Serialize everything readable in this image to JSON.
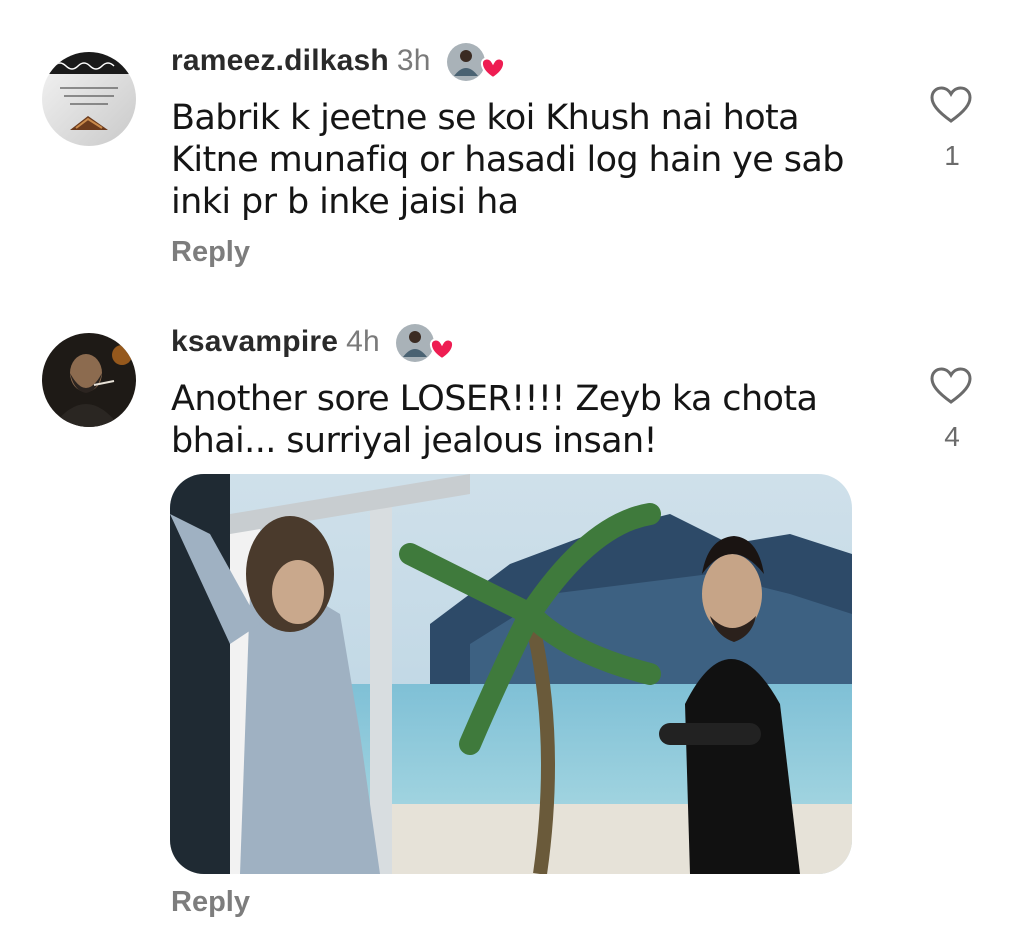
{
  "comments": [
    {
      "username": "rameez.dilkash",
      "time": "3h",
      "text": "Babrik k jeetne se koi Khush nai hota\nKitne munafiq or hasadi log hain ye sab\ninki pr b inke jaisi ha",
      "like_count": "1",
      "reply_label": "Reply",
      "avatar_icon": "quran-calligraphy-avatar",
      "liked_by_creator_icon": "creator-heart-badge"
    },
    {
      "username": "ksavampire",
      "time": "4h",
      "text": "Another sore LOSER!!!! Zeyb ka chota\nbhai... surriyal jealous insan!",
      "like_count": "4",
      "reply_label": "Reply",
      "avatar_icon": "man-smoking-avatar",
      "liked_by_creator_icon": "creator-heart-badge",
      "media": "video-still-beach-set"
    }
  ],
  "colors": {
    "heart_red": "#ee1d52",
    "muted_text": "#7d7d7d",
    "text": "#151515"
  }
}
